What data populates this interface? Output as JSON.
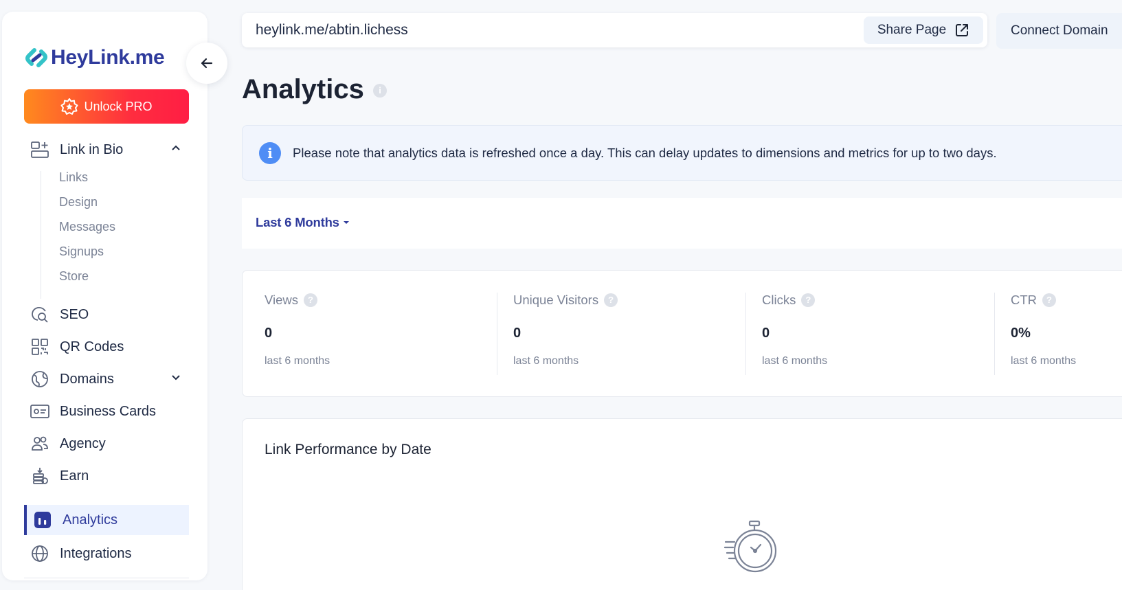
{
  "brand": {
    "name": "HeyLink.me"
  },
  "sidebar": {
    "unlock_label": "Unlock PRO",
    "items": [
      {
        "label": "Link in Bio",
        "icon": "link-in-bio-icon"
      },
      {
        "label": "SEO",
        "icon": "seo-icon"
      },
      {
        "label": "QR Codes",
        "icon": "qr-code-icon"
      },
      {
        "label": "Domains",
        "icon": "globe-icon"
      },
      {
        "label": "Business Cards",
        "icon": "business-card-icon"
      },
      {
        "label": "Agency",
        "icon": "agency-icon"
      },
      {
        "label": "Earn",
        "icon": "earn-icon"
      },
      {
        "label": "Analytics",
        "icon": "analytics-icon"
      },
      {
        "label": "Integrations",
        "icon": "integrations-icon"
      }
    ],
    "sub_items": [
      "Links",
      "Design",
      "Messages",
      "Signups",
      "Store"
    ]
  },
  "topbar": {
    "url": "heylink.me/abtin.lichess",
    "share_label": "Share Page",
    "connect_label": "Connect Domain"
  },
  "page": {
    "title": "Analytics",
    "notice": "Please note that analytics data is refreshed once a day. This can delay updates to dimensions and metrics for up to two days.",
    "filter_label": "Last 6 Months"
  },
  "stats": [
    {
      "label": "Views",
      "value": "0",
      "sub": "last 6 months"
    },
    {
      "label": "Unique Visitors",
      "value": "0",
      "sub": "last 6 months"
    },
    {
      "label": "Clicks",
      "value": "0",
      "sub": "last 6 months"
    },
    {
      "label": "CTR",
      "value": "0%",
      "sub": "last 6 months"
    }
  ],
  "performance": {
    "title": "Link Performance by Date"
  },
  "colors": {
    "brand": "#2f3b9c",
    "accent_teal": "#34c3c8",
    "info": "#4f8df5",
    "unlock_start": "#ff8a1e",
    "unlock_end": "#ff1e44"
  }
}
